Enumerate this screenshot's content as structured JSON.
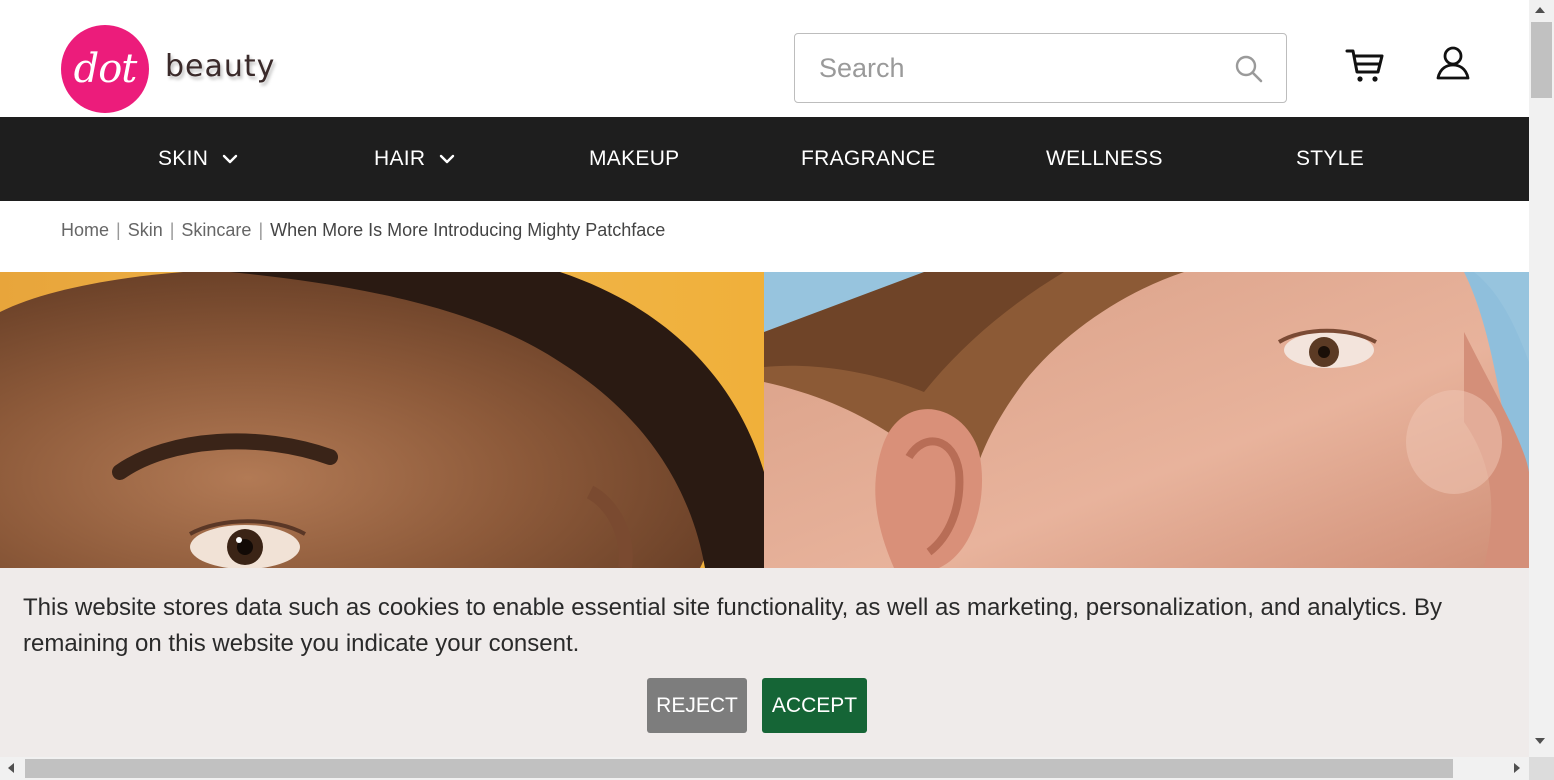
{
  "brand": {
    "logo_mark": "dot",
    "logo_word": "beauty",
    "accent": "#ec1c7b"
  },
  "search": {
    "placeholder": "Search",
    "value": ""
  },
  "header_icons": {
    "search": "search-icon",
    "cart": "cart-icon",
    "account": "user-icon"
  },
  "nav": {
    "items": [
      {
        "label": "SKIN",
        "has_dropdown": true
      },
      {
        "label": "HAIR",
        "has_dropdown": true
      },
      {
        "label": "MAKEUP",
        "has_dropdown": false
      },
      {
        "label": "FRAGRANCE",
        "has_dropdown": false
      },
      {
        "label": "WELLNESS",
        "has_dropdown": false
      },
      {
        "label": "STYLE",
        "has_dropdown": false
      }
    ],
    "background": "#1e1e1e"
  },
  "breadcrumb": {
    "items": [
      "Home",
      "Skin",
      "Skincare"
    ],
    "separator": "|",
    "current": "When More Is More Introducing Mighty Patchface"
  },
  "cookie_banner": {
    "text": "This website stores data such as cookies to enable essential site functionality, as well as marketing, personalization, and analytics. By remaining on this website you indicate your consent.",
    "reject_label": "REJECT",
    "accept_label": "ACCEPT",
    "accept_color": "#156536",
    "reject_color": "#7d7d7d"
  }
}
